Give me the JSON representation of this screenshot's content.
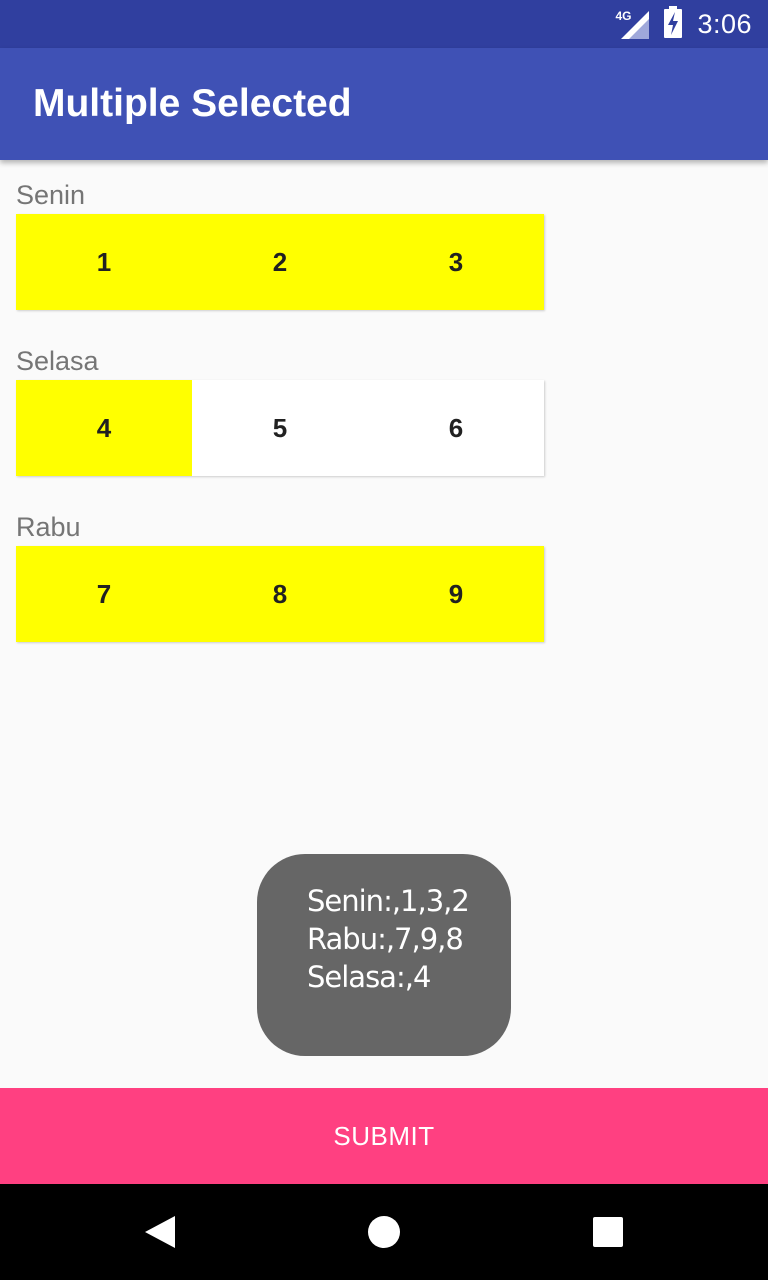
{
  "status_bar": {
    "network": "4G",
    "time": "3:06"
  },
  "app_bar": {
    "title": "Multiple Selected"
  },
  "days": [
    {
      "label": "Senin",
      "slots": [
        {
          "value": "1",
          "selected": true
        },
        {
          "value": "2",
          "selected": true
        },
        {
          "value": "3",
          "selected": true
        }
      ]
    },
    {
      "label": "Selasa",
      "slots": [
        {
          "value": "4",
          "selected": true
        },
        {
          "value": "5",
          "selected": false
        },
        {
          "value": "6",
          "selected": false
        }
      ]
    },
    {
      "label": "Rabu",
      "slots": [
        {
          "value": "7",
          "selected": true
        },
        {
          "value": "8",
          "selected": true
        },
        {
          "value": "9",
          "selected": true
        }
      ]
    }
  ],
  "toast": {
    "lines": [
      "Senin:,1,3,2",
      "Rabu:,7,9,8",
      "Selasa:,4"
    ]
  },
  "submit_label": "SUBMIT",
  "colors": {
    "status_bar": "#303f9f",
    "app_bar": "#3f51b5",
    "selected": "#ffff00",
    "unselected": "#ffffff",
    "accent": "#ff4081",
    "toast_bg": "#666666"
  },
  "icons": {
    "network": "signal-icon",
    "battery": "battery-charging-icon",
    "nav_back": "back-icon",
    "nav_home": "home-icon",
    "nav_recents": "recents-icon"
  }
}
